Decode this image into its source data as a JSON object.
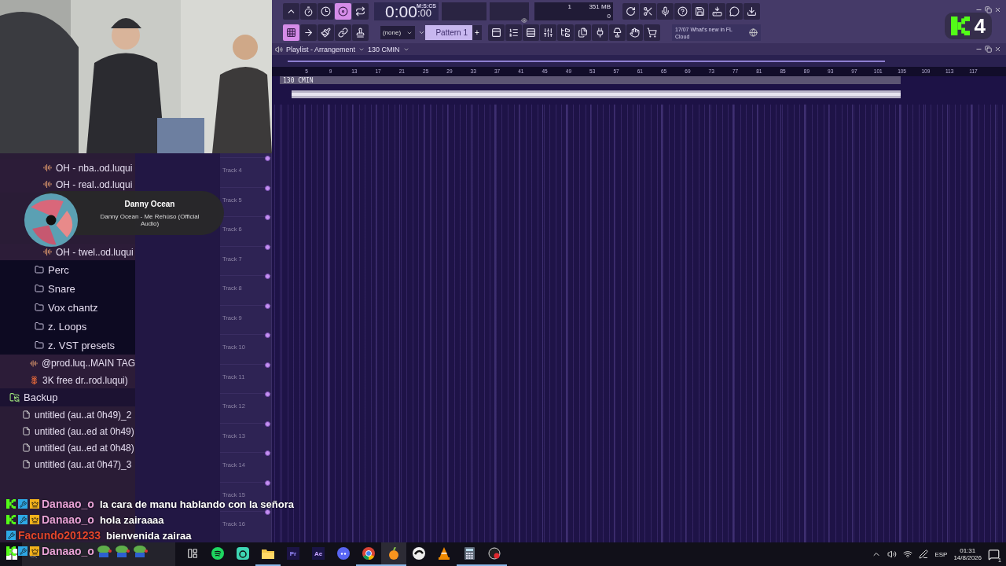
{
  "toolbar": {
    "row1_left": [
      {
        "kind": "metronome",
        "selected": false
      },
      {
        "kind": "wait",
        "selected": false
      },
      {
        "kind": "countdown",
        "selected": false
      },
      {
        "kind": "record",
        "selected": true
      },
      {
        "kind": "loop",
        "selected": false
      }
    ],
    "time": "0:00",
    "time_cs": ":00",
    "time_format": "M:S:CS",
    "cpu": "1",
    "memory": "351 MB",
    "polyphony": "0",
    "row1_right": [
      {
        "kind": "refresh"
      },
      {
        "kind": "cut"
      },
      {
        "kind": "mic"
      },
      {
        "kind": "help"
      },
      {
        "kind": "save"
      },
      {
        "kind": "drive"
      },
      {
        "kind": "chat"
      },
      {
        "kind": "download"
      }
    ],
    "row2_left": [
      {
        "kind": "grid",
        "selected": true
      },
      {
        "kind": "arrow",
        "selected": false
      },
      {
        "kind": "brush",
        "selected": false
      },
      {
        "kind": "link",
        "selected": false
      },
      {
        "kind": "stamp",
        "selected": false
      }
    ],
    "snap": "(none)",
    "pattern": "Pattern 1",
    "pattern_add": "+",
    "row2_right": [
      {
        "kind": "panel"
      },
      {
        "kind": "steps"
      },
      {
        "kind": "rows"
      },
      {
        "kind": "mixer"
      },
      {
        "kind": "tree"
      },
      {
        "kind": "files"
      },
      {
        "kind": "plug"
      },
      {
        "kind": "lamp"
      },
      {
        "kind": "hand"
      },
      {
        "kind": "cart"
      }
    ],
    "news": {
      "date": "17/07",
      "text": "What's new in FL Cloud"
    }
  },
  "browser": {
    "top_items": [
      {
        "kind": "audio",
        "label": "OH - nba..od.luqui"
      },
      {
        "kind": "audio",
        "label": "OH - real..od.luqui"
      }
    ],
    "items": [
      {
        "kind": "audio",
        "label": "OH - twel..od.luqui"
      },
      {
        "kind": "folder",
        "label": "Perc"
      },
      {
        "kind": "folder",
        "label": "Snare"
      },
      {
        "kind": "folder",
        "label": "Vox chantz"
      },
      {
        "kind": "folder",
        "label": "z. Loops"
      },
      {
        "kind": "folder",
        "label": "z. VST presets"
      },
      {
        "kind": "tag",
        "label": "@prod.luq..MAIN TAG"
      },
      {
        "kind": "plugin",
        "label": "3K free dr..rod.luqui)"
      },
      {
        "kind": "backup",
        "label": "Backup",
        "children": [
          {
            "kind": "file",
            "label": "untitled (au..at 0h49)_2"
          },
          {
            "kind": "file",
            "label": "untitled (au..ed at 0h49)"
          },
          {
            "kind": "file",
            "label": "untitled (au..ed at 0h48)"
          },
          {
            "kind": "file",
            "label": "untitled (au..at 0h47)_3"
          }
        ]
      }
    ]
  },
  "tracks": [
    "Track 4",
    "Track 5",
    "Track 6",
    "Track 7",
    "Track 8",
    "Track 9",
    "Track 10",
    "Track 11",
    "Track 12",
    "Track 13",
    "Track 14",
    "Track 15",
    "Track 16"
  ],
  "playlist": {
    "title": "Playlist - Arrangement",
    "pattern": "130 CMIN",
    "ruler": [
      "5",
      "9",
      "13",
      "17",
      "21",
      "25",
      "29",
      "33",
      "37",
      "41",
      "45",
      "49",
      "53",
      "57",
      "61",
      "65",
      "69",
      "73",
      "77",
      "81",
      "85",
      "89",
      "93",
      "97",
      "101",
      "105",
      "109",
      "113",
      "117"
    ],
    "clip_label": "130 CMIN"
  },
  "now_playing": {
    "artist": "Danny Ocean",
    "title": "Danny Ocean - Me Rehúso (Official Audio)"
  },
  "viewer_badge": {
    "count": "4"
  },
  "chat": [
    {
      "kind": "text",
      "user": "Danaao_o",
      "color": "#e8a2d6",
      "kick_badge": true,
      "moderator": true,
      "crown_badge": true,
      "text": "la cara de manu hablando con la señora"
    },
    {
      "kind": "text",
      "user": "Danaao_o",
      "color": "#e8a2d6",
      "kick_badge": true,
      "moderator": true,
      "crown_badge": true,
      "text": "hola zairaaaa"
    },
    {
      "kind": "text",
      "user": "Facundo201233",
      "color": "#e2462c",
      "kick_badge": false,
      "moderator": true,
      "crown_badge": false,
      "text": "bienvenida zairaa"
    },
    {
      "kind": "emotes",
      "user": "Danaao_o",
      "color": "#e8a2d6",
      "kick_badge": true,
      "moderator": true,
      "crown_badge": true
    }
  ],
  "taskbar": {
    "apps": [
      {
        "kind": "taskview",
        "open": false,
        "selected": false
      },
      {
        "kind": "spotify",
        "open": false,
        "selected": false
      },
      {
        "kind": "teal",
        "open": false,
        "selected": false
      },
      {
        "kind": "folder",
        "open": true,
        "selected": false
      },
      {
        "kind": "pr",
        "label": "Pr",
        "open": false,
        "selected": false
      },
      {
        "kind": "ae",
        "label": "Ae",
        "open": false,
        "selected": false
      },
      {
        "kind": "discord",
        "open": false,
        "selected": false
      },
      {
        "kind": "chrome",
        "open": true,
        "selected": false
      },
      {
        "kind": "fl",
        "open": true,
        "selected": true
      },
      {
        "kind": "cursor",
        "open": false,
        "selected": false
      },
      {
        "kind": "vlc",
        "open": false,
        "selected": false
      },
      {
        "kind": "calc",
        "open": true,
        "selected": false
      },
      {
        "kind": "obs",
        "open": true,
        "selected": false
      }
    ],
    "language": "ESP",
    "time": "01:31",
    "date": "14/8/2026",
    "notifications": "1"
  }
}
